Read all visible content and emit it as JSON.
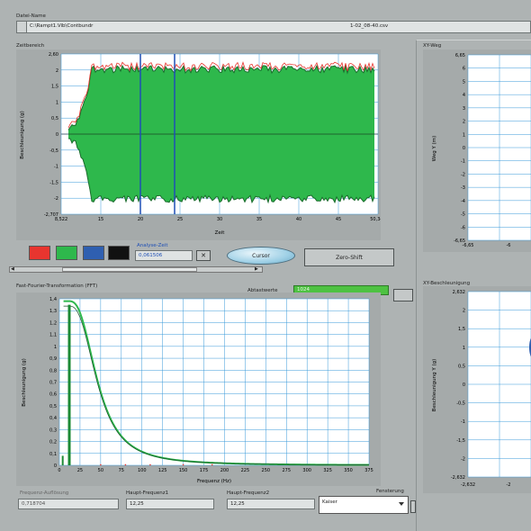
{
  "file_section": {
    "label": "Datei-Name",
    "path": "C:\\Rampt1.Vib\\Contbundr",
    "filename": "1-02_08-40.csv"
  },
  "time_plot": {
    "title": "Zeitbereich",
    "ylabel": "Beschleunigung (g)",
    "xlabel": "Zeit",
    "y_ticks": [
      "2,60",
      "2",
      "1,5",
      "1",
      "0,5",
      "0",
      "-0,5",
      "-1",
      "-1,5",
      "-2",
      "-2,707"
    ],
    "x_ticks": [
      "8,522",
      "15",
      "20",
      "25",
      "30",
      "35",
      "40",
      "45",
      "50,347"
    ]
  },
  "colors": {
    "red": "#e8352f",
    "green": "#2eb84c",
    "blue": "#2f5fb0",
    "black": "#111111",
    "cursor": "#1f4fb5",
    "plot_bg": "#ffffff",
    "grid": "#3a9ad9"
  },
  "analysis": {
    "label": "Analyse-Zeit",
    "value": "0,061506",
    "cursor_button": "Cursor",
    "zero_shift_button": "Zero-Shift"
  },
  "fft_plot": {
    "title": "Fast-Fourier-Transformation (FFT)",
    "sampling_label": "Abtastwerte",
    "sampling_value": "1024",
    "ylabel": "Beschleunigung (g)",
    "xlabel": "Frequenz (Hz)",
    "y_ticks": [
      "1,4",
      "1,3",
      "1,2",
      "1,1",
      "1",
      "0,9",
      "0,8",
      "0,7",
      "0,6",
      "0,5",
      "0,4",
      "0,3",
      "0,2",
      "0,1",
      "0"
    ],
    "x_ticks": [
      "0",
      "25",
      "50",
      "75",
      "100",
      "125",
      "150",
      "175",
      "200",
      "225",
      "250",
      "275",
      "300",
      "325",
      "350",
      "375"
    ]
  },
  "xy_path": {
    "title": "XY-Weg",
    "ylabel": "Weg Y (m)",
    "y_ticks": [
      "6,65",
      "6",
      "5",
      "4",
      "3",
      "2",
      "1",
      "0",
      "-1",
      "-2",
      "-3",
      "-4",
      "-5",
      "-6",
      "-6,65"
    ],
    "x_ticks": [
      "-6,65",
      "-6"
    ]
  },
  "xy_accel": {
    "title": "XY-Beschleunigung",
    "ylabel": "Beschleunigung Y (g)",
    "y_ticks": [
      "2,632",
      "2",
      "1,5",
      "1",
      "0,5",
      "0",
      "-0,5",
      "-1",
      "-1,5",
      "-2",
      "-2,632"
    ],
    "x_ticks": [
      "-2,632",
      "-2"
    ]
  },
  "bottom": {
    "freq_res_label": "Frequenz-Auflösung",
    "freq_res_value": "0,718704",
    "main_freq1_label": "Haupt-Frequenz1",
    "main_freq1_value": "12,25",
    "main_freq2_label": "Haupt-Frequenz2",
    "main_freq2_value": "12,25",
    "window_label": "Fensterung",
    "window_value": "Kaiser"
  }
}
